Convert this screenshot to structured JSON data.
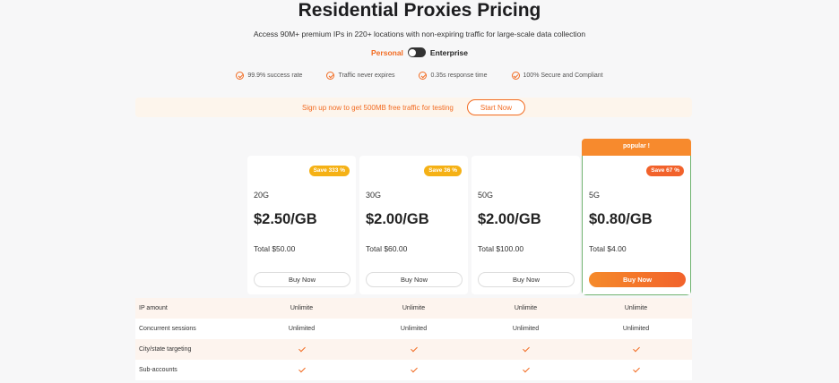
{
  "header": {
    "title": "Residential Proxies Pricing",
    "subtitle": "Access 90M+ premium IPs in 220+ locations with non-expiring traffic for large-scale data collection",
    "toggle": {
      "left": "Personal",
      "right": "Enterprise"
    }
  },
  "features": [
    "99.9% success rate",
    "Traffic never expires",
    "0.35s response time",
    "100% Secure and Compliant"
  ],
  "banner": {
    "text": "Sign up now to get 500MB free traffic for testing",
    "button": "Start Now"
  },
  "plans": [
    {
      "badge": "Save 333 %",
      "size": "20G",
      "price": "$2.50/GB",
      "total": "Total $50.00",
      "button": "Buy Now"
    },
    {
      "badge": "Save 36 %",
      "size": "30G",
      "price": "$2.00/GB",
      "total": "Total $60.00",
      "button": "Buy Now"
    },
    {
      "badge": "",
      "size": "50G",
      "price": "$2.00/GB",
      "total": "Total $100.00",
      "button": "Buy Now"
    },
    {
      "badge": "Save 67 %",
      "size": "5G",
      "price": "$0.80/GB",
      "total": "Total $4.00",
      "button": "Buy Now",
      "popular": "popular !"
    }
  ],
  "table": {
    "rows": [
      {
        "label": "IP amount",
        "values": [
          "Unlimite",
          "Unlimite",
          "Unlimite",
          "Unlimite"
        ]
      },
      {
        "label": "Concurrent sessions",
        "values": [
          "Unlimited",
          "Unlimited",
          "Unlimited",
          "Unlimited"
        ]
      },
      {
        "label": "City/state targeting",
        "values": [
          "check",
          "check",
          "check",
          "check"
        ]
      },
      {
        "label": "Sub-accounts",
        "values": [
          "check",
          "check",
          "check",
          "check"
        ]
      }
    ]
  },
  "colors": {
    "accent": "#f26b21",
    "badge_yellow": "#f5b115",
    "popular_border": "#6fb36f"
  }
}
